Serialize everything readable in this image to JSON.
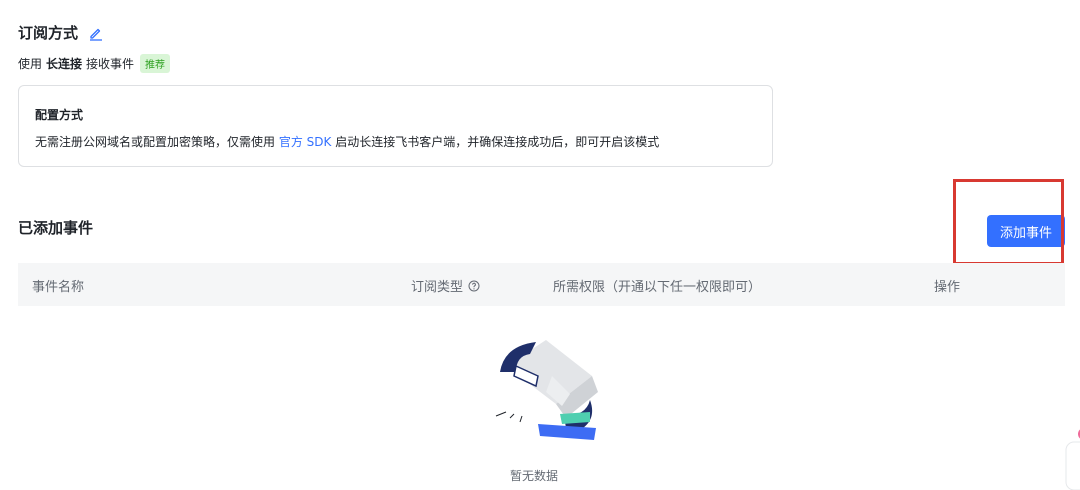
{
  "subscription": {
    "title": "订阅方式",
    "method_prefix": "使用",
    "method_bold": "长连接",
    "method_suffix": "接收事件",
    "recommend_tag": "推荐"
  },
  "config": {
    "title": "配置方式",
    "desc_before": "无需注册公网域名或配置加密策略，仅需使用",
    "desc_link": "官方 SDK",
    "desc_after": "启动长连接飞书客户端，并确保连接成功后，即可开启该模式"
  },
  "events": {
    "title": "已添加事件",
    "add_button": "添加事件",
    "columns": [
      "事件名称",
      "订阅类型",
      "所需权限（开通以下任一权限即可）",
      "操作"
    ],
    "empty_text": "暂无数据"
  },
  "colors": {
    "accent": "#3370ff",
    "highlight": "#d83931",
    "tag_bg": "#d9f5d6",
    "tag_fg": "#2ea121"
  }
}
